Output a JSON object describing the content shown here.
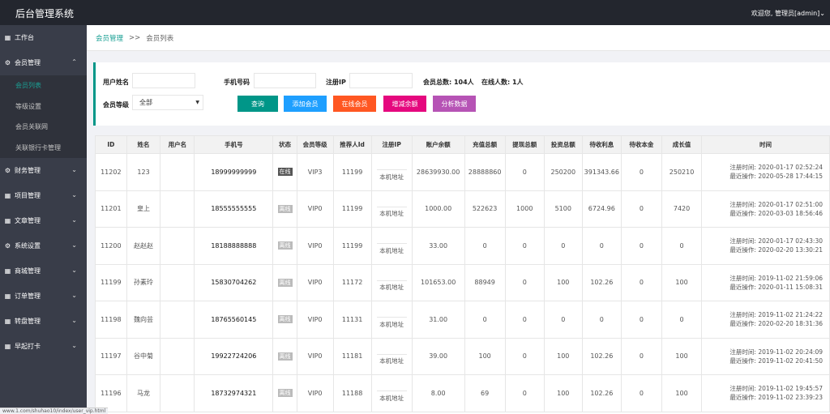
{
  "header": {
    "title": "后台管理系统",
    "welcome": "欢迎您, 管理员[admin]",
    "chevron": "chevron-down-icon"
  },
  "sidebar": {
    "items": [
      {
        "icon": "grid-icon",
        "label": "工作台",
        "expandable": false
      },
      {
        "icon": "gear-icon",
        "label": "会员管理",
        "expandable": true,
        "expanded": true,
        "children": [
          "会员列表",
          "等级设置",
          "会员关联网",
          "关联银行卡管理"
        ],
        "active_child": 0
      },
      {
        "icon": "gear-icon",
        "label": "财务管理",
        "expandable": true
      },
      {
        "icon": "grid-icon",
        "label": "项目管理",
        "expandable": true
      },
      {
        "icon": "grid-icon",
        "label": "文章管理",
        "expandable": true
      },
      {
        "icon": "gear-icon",
        "label": "系统设置",
        "expandable": true
      },
      {
        "icon": "grid-icon",
        "label": "商城管理",
        "expandable": true
      },
      {
        "icon": "grid-icon",
        "label": "订单管理",
        "expandable": true
      },
      {
        "icon": "grid-icon",
        "label": "转盘管理",
        "expandable": true
      },
      {
        "icon": "grid-icon",
        "label": "早起打卡",
        "expandable": true
      }
    ]
  },
  "breadcrumb": {
    "parent": "会员管理",
    "sep": ">>",
    "current": "会员列表"
  },
  "filters": {
    "username_label": "用户姓名",
    "username_value": "",
    "phone_label": "手机号码",
    "phone_value": "",
    "ip_label": "注册IP",
    "ip_value": "",
    "total_members": "会员总数: 104人",
    "online_count": "在线人数: 1人",
    "level_label": "会员等级",
    "level_value": "全部"
  },
  "buttons": [
    {
      "label": "查询",
      "color": "#009688"
    },
    {
      "label": "添加会员",
      "color": "#1e9fff"
    },
    {
      "label": "在线会员",
      "color": "#ff5722"
    },
    {
      "label": "增减余额",
      "color": "#e5087e"
    },
    {
      "label": "分析数据",
      "color": "#b653b5"
    }
  ],
  "table": {
    "columns": [
      "ID",
      "姓名",
      "用户名",
      "手机号",
      "状态",
      "会员等级",
      "推荐人Id",
      "注册IP",
      "账户余额",
      "充值总额",
      "提现总额",
      "投资总额",
      "待收利息",
      "待收本金",
      "成长值",
      "时间"
    ],
    "rows": [
      {
        "id": "11202",
        "name": "123",
        "username": "",
        "phone": "18999999999",
        "status": "在线",
        "online": true,
        "level": "VIP3",
        "ref": "11199",
        "ip": "本机地址",
        "balance": "28639930.00",
        "recharge": "28888860",
        "withdraw": "0",
        "invest": "250200",
        "interest": "391343.66",
        "principal": "0",
        "growth": "250210",
        "reg": "注册时间: 2020-01-17 02:52:24",
        "last": "最近操作: 2020-05-28 17:44:15"
      },
      {
        "id": "11201",
        "name": "皇上",
        "username": "",
        "phone": "18555555555",
        "status": "离线",
        "online": false,
        "level": "VIP0",
        "ref": "11199",
        "ip": "本机地址",
        "balance": "1000.00",
        "recharge": "522623",
        "withdraw": "1000",
        "invest": "5100",
        "interest": "6724.96",
        "principal": "0",
        "growth": "7420",
        "reg": "注册时间: 2020-01-17 02:51:00",
        "last": "最近操作: 2020-03-03 18:56:46"
      },
      {
        "id": "11200",
        "name": "赵赵赵",
        "username": "",
        "phone": "18188888888",
        "status": "离线",
        "online": false,
        "level": "VIP0",
        "ref": "11199",
        "ip": "本机地址",
        "balance": "33.00",
        "recharge": "0",
        "withdraw": "0",
        "invest": "0",
        "interest": "0",
        "principal": "0",
        "growth": "0",
        "reg": "注册时间: 2020-01-17 02:43:30",
        "last": "最近操作: 2020-02-20 13:30:21"
      },
      {
        "id": "11199",
        "name": "孙素玲",
        "username": "",
        "phone": "15830704262",
        "status": "离线",
        "online": false,
        "level": "VIP0",
        "ref": "11172",
        "ip": "本机地址",
        "balance": "101653.00",
        "recharge": "88949",
        "withdraw": "0",
        "invest": "100",
        "interest": "102.26",
        "principal": "0",
        "growth": "100",
        "reg": "注册时间: 2019-11-02 21:59:06",
        "last": "最近操作: 2020-01-11 15:08:31"
      },
      {
        "id": "11198",
        "name": "魏向芸",
        "username": "",
        "phone": "18765560145",
        "status": "离线",
        "online": false,
        "level": "VIP0",
        "ref": "11131",
        "ip": "本机地址",
        "balance": "31.00",
        "recharge": "0",
        "withdraw": "0",
        "invest": "0",
        "interest": "0",
        "principal": "0",
        "growth": "0",
        "reg": "注册时间: 2019-11-02 21:24:22",
        "last": "最近操作: 2020-02-20 18:31:36"
      },
      {
        "id": "11197",
        "name": "谷中菊",
        "username": "",
        "phone": "19922724206",
        "status": "离线",
        "online": false,
        "level": "VIP0",
        "ref": "11181",
        "ip": "本机地址",
        "balance": "39.00",
        "recharge": "100",
        "withdraw": "0",
        "invest": "100",
        "interest": "102.26",
        "principal": "0",
        "growth": "100",
        "reg": "注册时间: 2019-11-02 20:24:09",
        "last": "最近操作: 2019-11-02 20:41:50"
      },
      {
        "id": "11196",
        "name": "马龙",
        "username": "",
        "phone": "18732974321",
        "status": "离线",
        "online": false,
        "level": "VIP0",
        "ref": "11188",
        "ip": "本机地址",
        "balance": "8.00",
        "recharge": "69",
        "withdraw": "0",
        "invest": "100",
        "interest": "102.26",
        "principal": "0",
        "growth": "100",
        "reg": "注册时间: 2019-11-02 19:45:57",
        "last": "最近操作: 2019-11-02 23:39:23"
      }
    ]
  },
  "statusbar": {
    "url": "www.1.com/shuhao10/index/user_vip.html"
  }
}
